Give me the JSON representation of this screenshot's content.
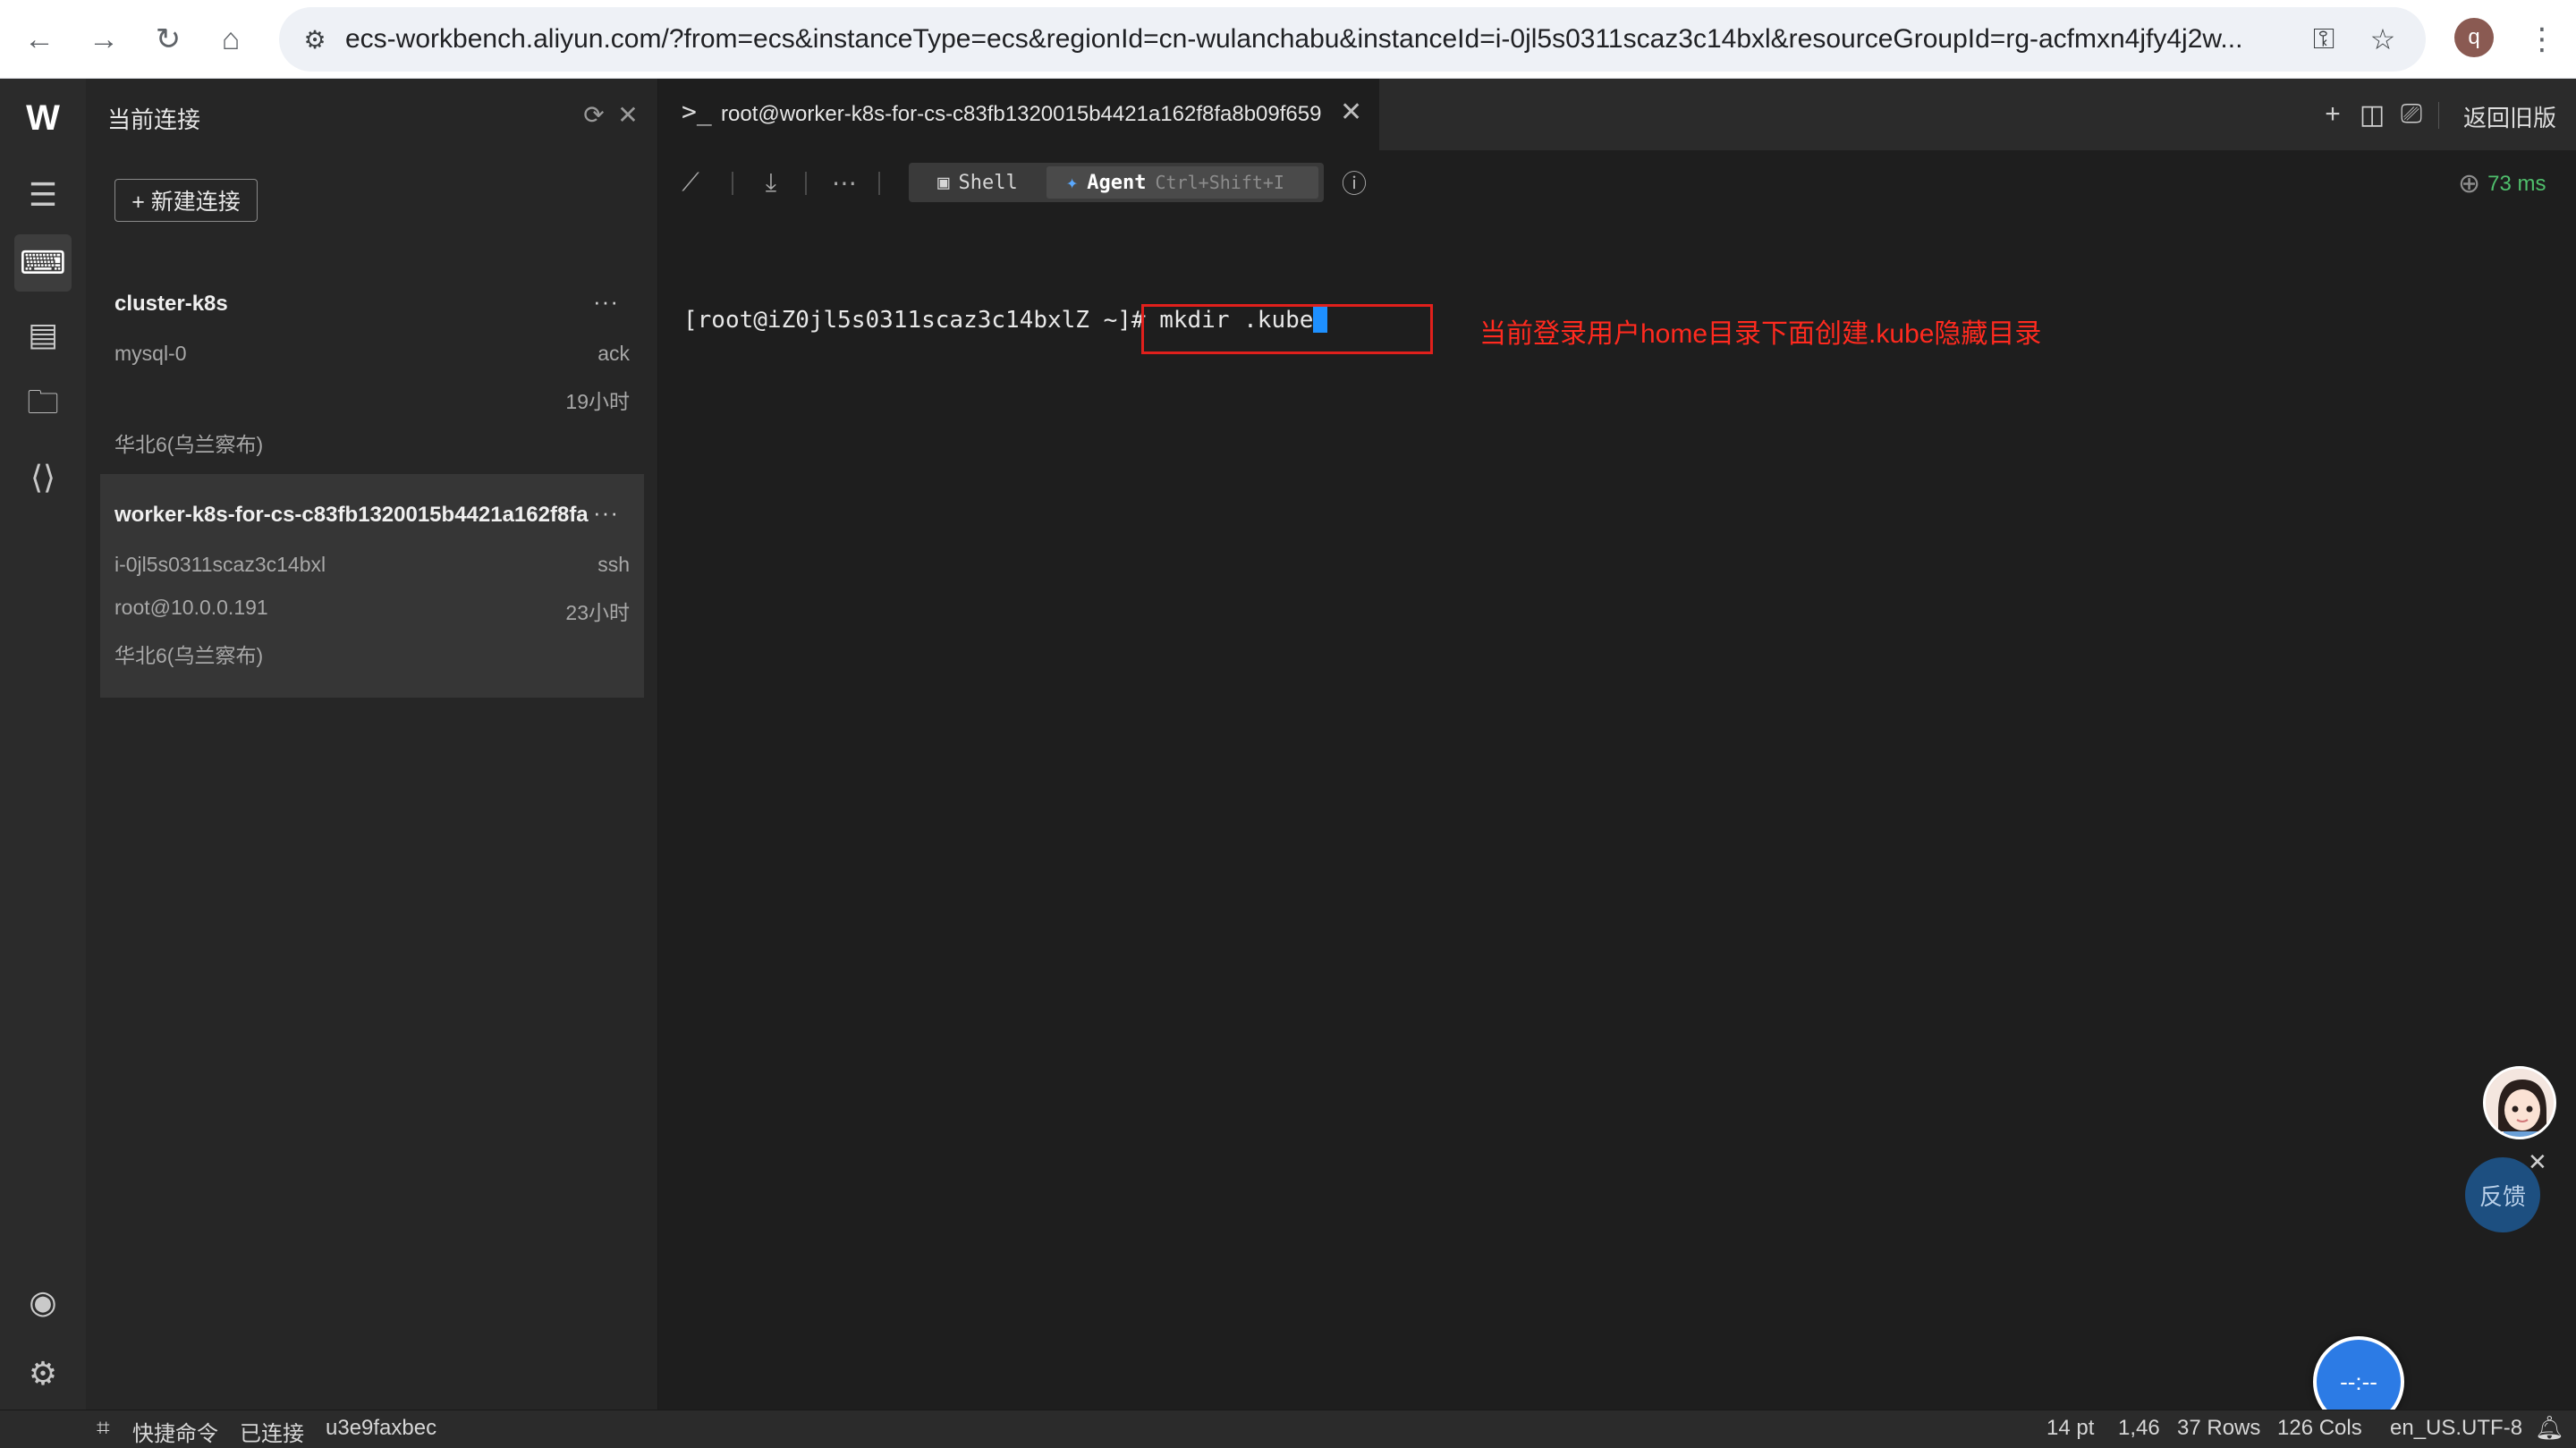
{
  "browser": {
    "url": "ecs-workbench.aliyun.com/?from=ecs&instanceType=ecs&regionId=cn-wulanchabu&instanceId=i-0jl5s0311scaz3c14bxl&resourceGroupId=rg-acfmxn4jfy4j2w...",
    "profile_initial": "q"
  },
  "side_panel": {
    "title": "当前连接",
    "new_connection_label": "+ 新建连接",
    "groups": [
      {
        "name": "cluster-k8s",
        "more": "···",
        "rows": [
          {
            "left": "mysql-0",
            "right": "ack"
          },
          {
            "left": "",
            "right": "19小时"
          },
          {
            "left": "华北6(乌兰察布)",
            "right": ""
          }
        ]
      },
      {
        "name": "worker-k8s-for-cs-c83fb1320015b4421a162f8fa...",
        "more": "···",
        "rows": [
          {
            "left": "i-0jl5s0311scaz3c14bxl",
            "right": "ssh"
          },
          {
            "left": "root@10.0.0.191",
            "right": "23小时"
          },
          {
            "left": "华北6(乌兰察布)",
            "right": ""
          }
        ]
      }
    ]
  },
  "tabs": [
    {
      "label": "root@worker-k8s-for-cs-c83fb1320015b4421a162f8fa8b09f659"
    }
  ],
  "tabbar": {
    "return_old_label": "返回旧版"
  },
  "toolbar": {
    "shell_label": "Shell",
    "agent_label": "Agent",
    "agent_shortcut": "Ctrl+Shift+I",
    "latency": "73 ms"
  },
  "terminal": {
    "prompt": "[root@iZ0jl5s0311scaz3c14bxlZ ~]# ",
    "command": "mkdir .kube",
    "annotation": "当前登录用户home目录下面创建.kube隐藏目录"
  },
  "floating": {
    "feedback_label": "反馈",
    "float_button_label": "--:--"
  },
  "statusbar": {
    "quick_commands": "快捷命令",
    "connected": "已连接",
    "session_id": "u3e9faxbec",
    "font_size": "14 pt",
    "cursor_pos": "1,46",
    "rows": "37 Rows",
    "cols": "126 Cols",
    "locale": "en_US.UTF-8"
  },
  "colors": {
    "annotation": "#ff2a1f",
    "latency": "#4fbf6c",
    "cursor": "#1e90ff",
    "float_button": "#2c7be5"
  }
}
